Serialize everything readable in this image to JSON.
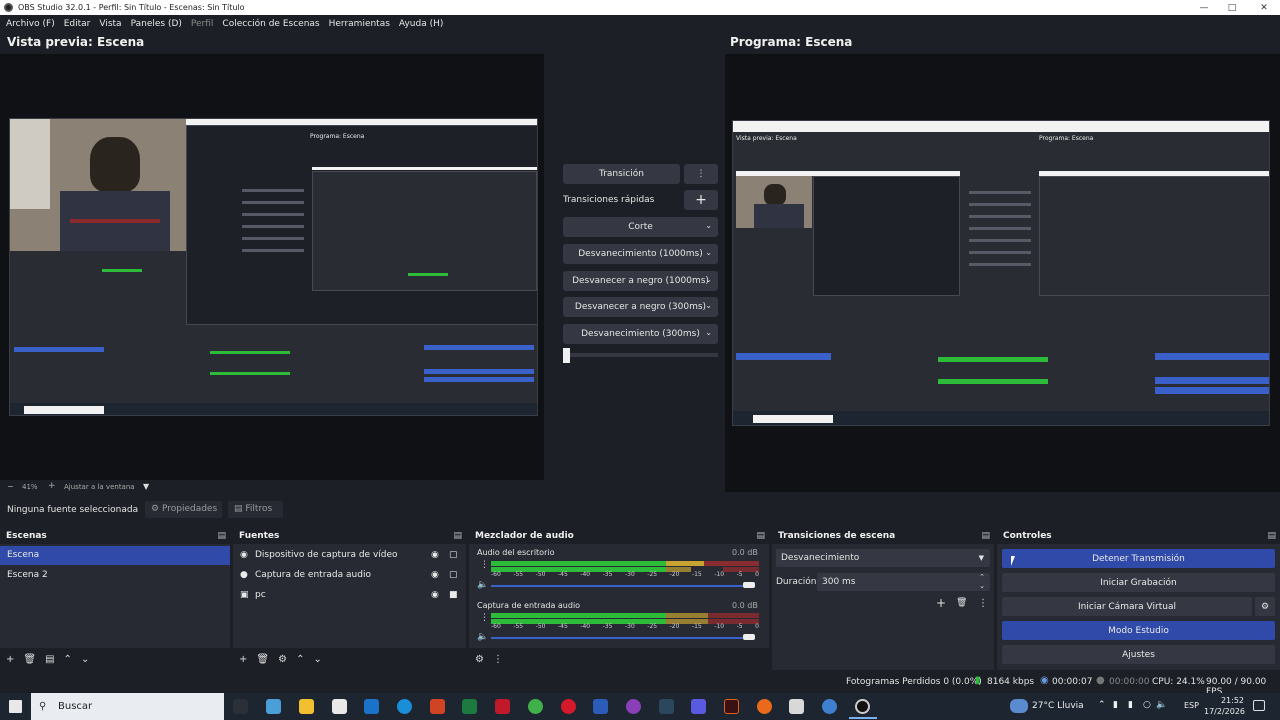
{
  "window": {
    "title": "OBS Studio 32.0.1 - Perfil: Sin Título - Escenas: Sin Título"
  },
  "menu": [
    "Archivo (F)",
    "Editar",
    "Vista",
    "Paneles (D)",
    "Perfil",
    "Colección de Escenas",
    "Herramientas",
    "Ayuda (H)"
  ],
  "preview": {
    "title": "Vista previa: Escena",
    "zoom": "41%",
    "fit_label": "Ajustar a la ventana"
  },
  "program": {
    "title": "Programa: Escena"
  },
  "transitions_panel": {
    "transition_label": "Transición",
    "quick_label": "Transiciones rápidas",
    "items": [
      "Corte",
      "Desvanecimiento (1000ms)",
      "Desvanecer a negro (1000ms)",
      "Desvanecer a negro (300ms)",
      "Desvanecimiento (300ms)"
    ]
  },
  "context_bar": {
    "no_source": "Ninguna fuente seleccionada",
    "properties": "Propiedades",
    "filters": "Filtros"
  },
  "scenes": {
    "title": "Escenas",
    "items": [
      "Escena",
      "Escena 2"
    ]
  },
  "sources": {
    "title": "Fuentes",
    "items": [
      "Dispositivo de captura de vídeo",
      "Captura de entrada audio",
      "pc"
    ]
  },
  "mixer": {
    "title": "Mezclador de audio",
    "channels": [
      {
        "name": "Audio del escritorio",
        "db": "0.0 dB"
      },
      {
        "name": "Captura de entrada audio",
        "db": "0.0 dB"
      }
    ],
    "scale": [
      "-60",
      "-55",
      "-50",
      "-45",
      "-40",
      "-35",
      "-30",
      "-25",
      "-20",
      "-15",
      "-10",
      "-5",
      "0"
    ]
  },
  "scene_transitions": {
    "title": "Transiciones de escena",
    "selected": "Desvanecimiento",
    "duration_label": "Duración",
    "duration_value": "300 ms"
  },
  "controls": {
    "title": "Controles",
    "stop_stream": "Detener Transmisión",
    "start_recording": "Iniciar Grabación",
    "virtual_cam": "Iniciar Cámara Virtual",
    "studio_mode": "Modo Estudio",
    "settings": "Ajustes"
  },
  "status": {
    "dropped": "Fotogramas Perdidos 0 (0.0%)",
    "bitrate": "8164 kbps",
    "stream_time": "00:00:07",
    "rec_time": "00:00:00",
    "cpu": "CPU: 24.1%",
    "fps": "90.00 / 90.00 FPS"
  },
  "taskbar": {
    "search": "Buscar",
    "weather": "27°C  Lluvia",
    "lang": "ESP",
    "time": "21:52",
    "date": "17/2/2026"
  },
  "colors": {
    "accent": "#2f4aa8",
    "panel": "#272a33",
    "background": "#1d1f26",
    "meter_green": "#2dbb3a",
    "meter_yellow": "#c9a331",
    "meter_red": "#b22d2d"
  }
}
